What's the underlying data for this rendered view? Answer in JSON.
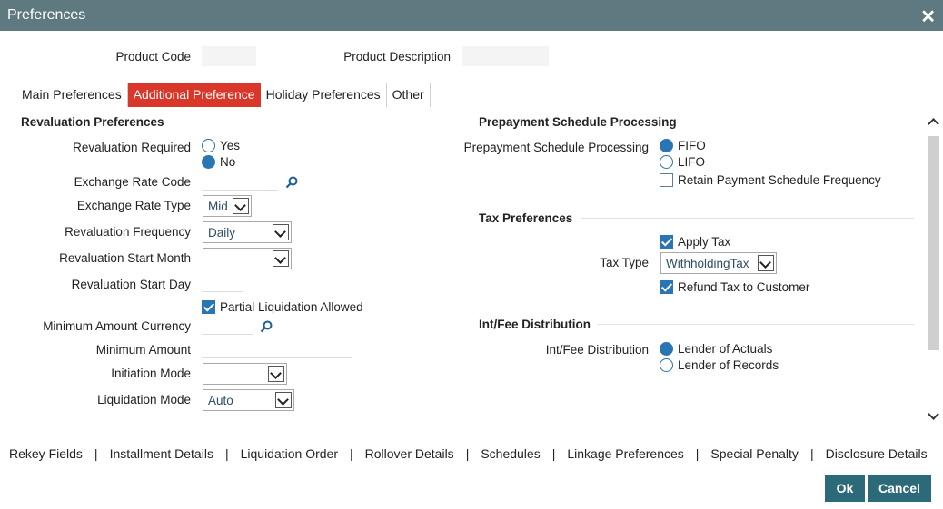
{
  "window": {
    "title": "Preferences",
    "close_icon": "close-icon"
  },
  "header": {
    "product_code_label": "Product Code",
    "product_code_value": "",
    "product_description_label": "Product Description",
    "product_description_value": ""
  },
  "tabs": [
    {
      "label": "Main Preferences",
      "active": false
    },
    {
      "label": "Additional Preference",
      "active": true
    },
    {
      "label": "Holiday Preferences",
      "active": false
    },
    {
      "label": "Other",
      "active": false
    }
  ],
  "revaluation": {
    "section_title": "Revaluation Preferences",
    "revaluation_required_label": "Revaluation Required",
    "yes_label": "Yes",
    "no_label": "No",
    "selected": "No",
    "exchange_rate_code_label": "Exchange Rate Code",
    "exchange_rate_code_value": "",
    "exchange_rate_type_label": "Exchange Rate Type",
    "exchange_rate_type_value": "Mid",
    "revaluation_frequency_label": "Revaluation Frequency",
    "revaluation_frequency_value": "Daily",
    "revaluation_start_month_label": "Revaluation Start Month",
    "revaluation_start_month_value": "",
    "revaluation_start_day_label": "Revaluation Start Day",
    "revaluation_start_day_value": "",
    "partial_liquidation_label": "Partial Liquidation Allowed",
    "partial_liquidation_checked": true,
    "minimum_amount_currency_label": "Minimum Amount Currency",
    "minimum_amount_currency_value": "",
    "minimum_amount_label": "Minimum Amount",
    "minimum_amount_value": "",
    "initiation_mode_label": "Initiation Mode",
    "initiation_mode_value": "",
    "liquidation_mode_label": "Liquidation Mode",
    "liquidation_mode_value": "Auto"
  },
  "prepayment": {
    "section_title": "Prepayment Schedule Processing",
    "field_label": "Prepayment Schedule Processing",
    "fifo_label": "FIFO",
    "lifo_label": "LIFO",
    "selected": "FIFO",
    "retain_label": "Retain Payment Schedule Frequency",
    "retain_checked": false
  },
  "tax": {
    "section_title": "Tax Preferences",
    "apply_tax_label": "Apply Tax",
    "apply_tax_checked": true,
    "tax_type_label": "Tax Type",
    "tax_type_value": "WithholdingTax",
    "refund_label": "Refund Tax to Customer",
    "refund_checked": true
  },
  "distribution": {
    "section_title": "Int/Fee Distribution",
    "field_label": "Int/Fee Distribution",
    "actuals_label": "Lender of Actuals",
    "records_label": "Lender of Records",
    "selected": "Lender of Actuals"
  },
  "bottom_links": [
    "Rekey Fields",
    "Installment Details",
    "Liquidation Order",
    "Rollover Details",
    "Schedules",
    "Linkage Preferences",
    "Special Penalty",
    "Disclosure Details"
  ],
  "bottom_separator": "|",
  "buttons": {
    "ok": "Ok",
    "cancel": "Cancel"
  },
  "colors": {
    "titlebar": "#5e7a80",
    "active_tab": "#d9372a",
    "button": "#2c6a7a",
    "radio_selected": "#2a75b3"
  }
}
